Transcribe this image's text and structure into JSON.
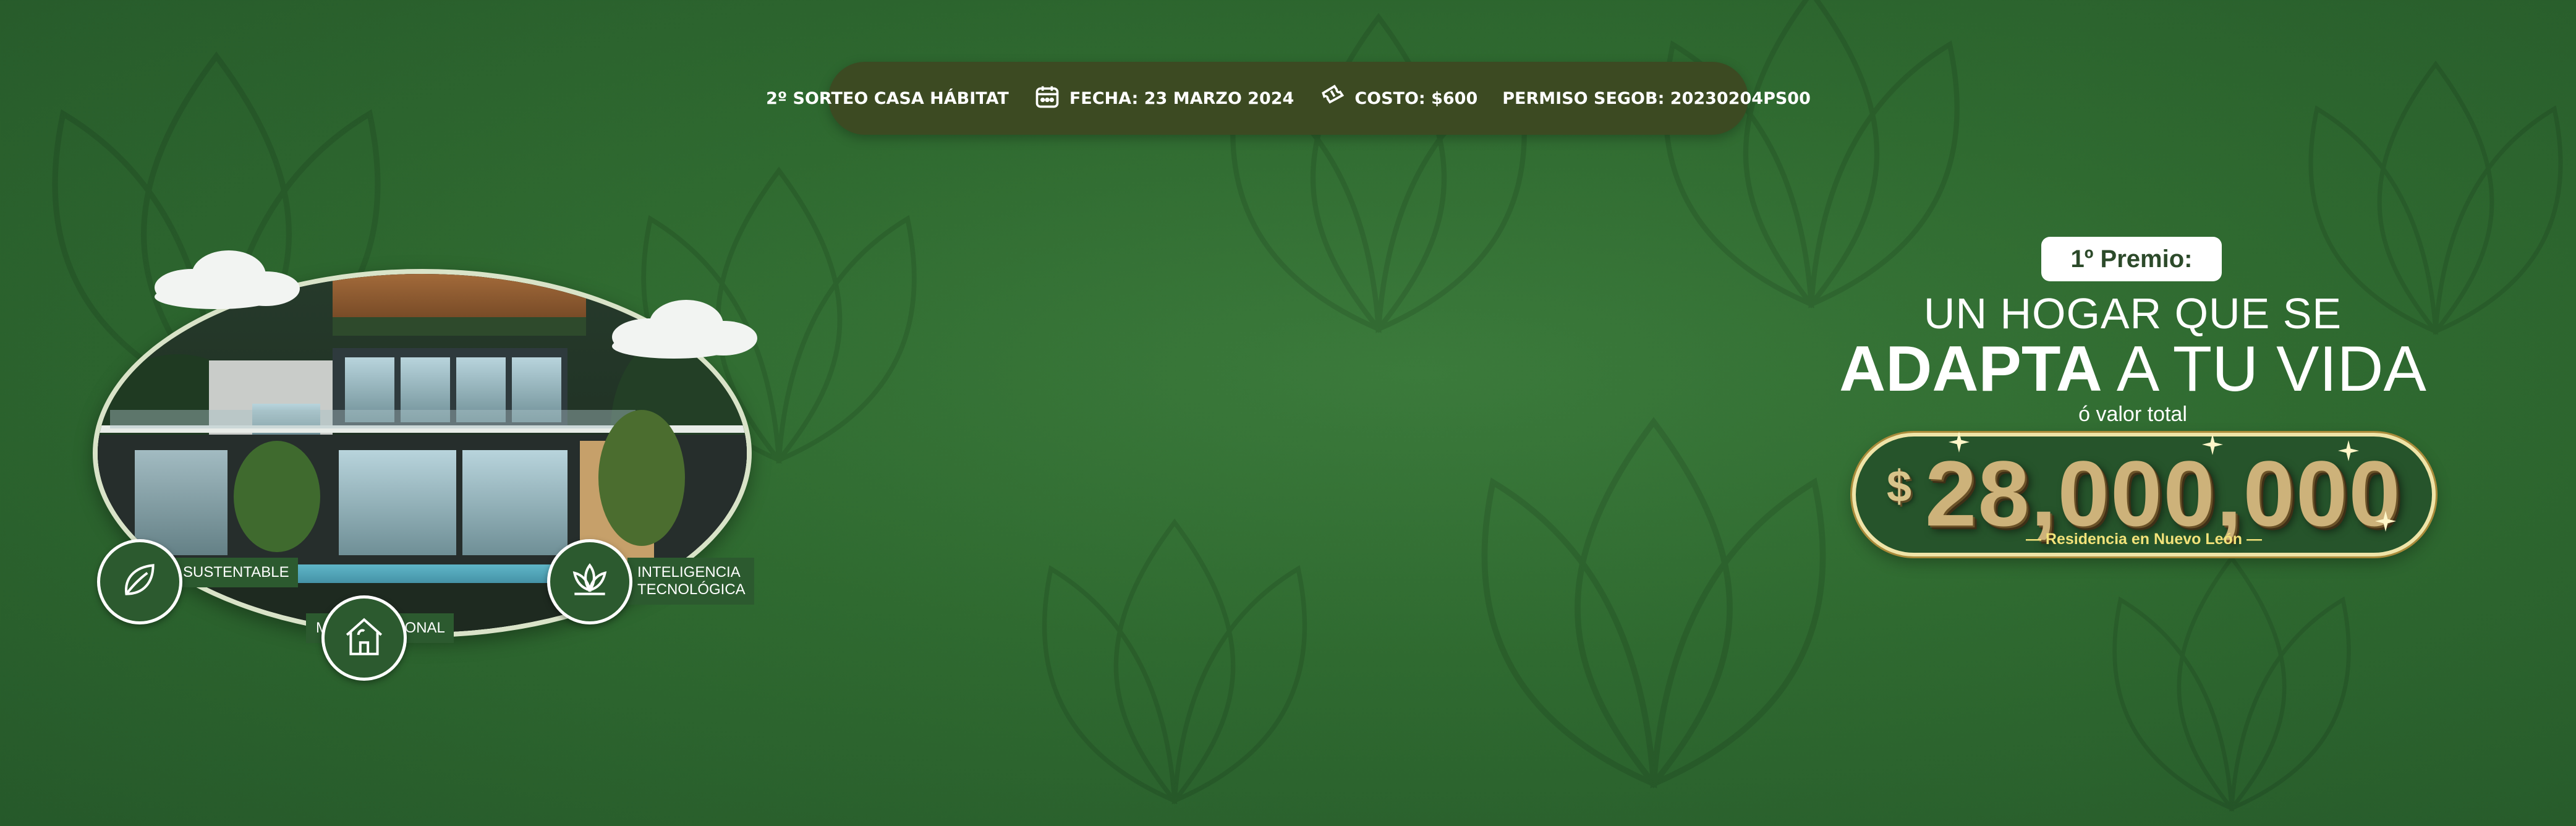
{
  "colors": {
    "background": "#2f6a30",
    "infobar": "#3c4a22",
    "badge": "#2c5a2f",
    "gold": "#cdb27a",
    "subtitle_yellow": "#f2e27a"
  },
  "infobar": {
    "raffle": "2º SORTEO CASA HÁBITAT",
    "date": "FECHA: 23 MARZO 2024",
    "cost": "COSTO: $600",
    "permit": "PERMISO SEGOB: 20230204PS00",
    "icons": [
      "calendar-icon",
      "ticket-icon"
    ]
  },
  "features": [
    {
      "label": "SUSTENTABLE",
      "icon": "leaf-icon"
    },
    {
      "label": "MULTIFUNCIONAL",
      "icon": "house-icon"
    },
    {
      "label": "INTELIGENCIA TECNOLÓGICA",
      "label_line1": "INTELIGENCIA",
      "label_line2": "TECNOLÓGICA",
      "icon": "lotus-icon"
    }
  ],
  "prize": {
    "badge": "1º Premio:",
    "line1": "UN HOGAR QUE SE",
    "line2_bold": "ADAPTA",
    "line2_rest": " A TU VIDA",
    "value_label": "ó valor total",
    "currency": "$",
    "amount": "28,000,000",
    "location": "— Residencia en Nuevo León —"
  }
}
